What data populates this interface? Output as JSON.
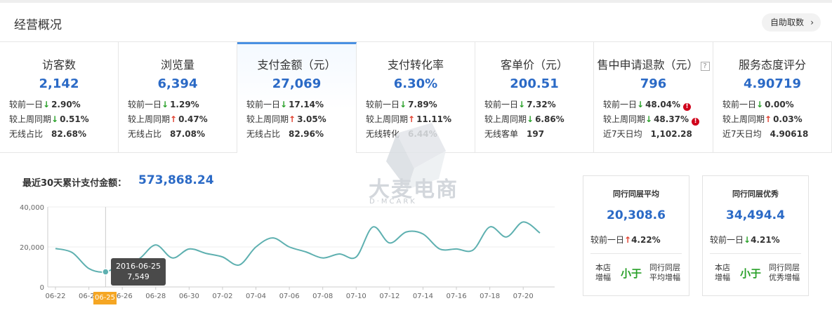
{
  "header": {
    "title": "经营概况",
    "button": "自助取数"
  },
  "metrics": [
    {
      "label": "访客数",
      "value": "2,142",
      "rows": [
        {
          "label": "较前一日",
          "dir": "down",
          "value": "2.90%"
        },
        {
          "label": "较上周同期",
          "dir": "down",
          "value": "0.51%"
        },
        {
          "label": "无线占比",
          "dir": "",
          "value": "82.68%"
        }
      ]
    },
    {
      "label": "浏览量",
      "value": "6,394",
      "rows": [
        {
          "label": "较前一日",
          "dir": "down",
          "value": "1.29%"
        },
        {
          "label": "较上周同期",
          "dir": "up",
          "value": "0.47%"
        },
        {
          "label": "无线占比",
          "dir": "",
          "value": "87.08%"
        }
      ]
    },
    {
      "label": "支付金额（元）",
      "value": "27,069",
      "rows": [
        {
          "label": "较前一日",
          "dir": "down",
          "value": "17.14%"
        },
        {
          "label": "较上周同期",
          "dir": "up",
          "value": "3.05%"
        },
        {
          "label": "无线占比",
          "dir": "",
          "value": "82.96%"
        }
      ]
    },
    {
      "label": "支付转化率",
      "value": "6.30%",
      "rows": [
        {
          "label": "较前一日",
          "dir": "down",
          "value": "7.89%"
        },
        {
          "label": "较上周同期",
          "dir": "up",
          "value": "11.11%"
        },
        {
          "label": "无线转化",
          "dir": "",
          "value": "6.44%"
        }
      ]
    },
    {
      "label": "客单价（元）",
      "value": "200.51",
      "rows": [
        {
          "label": "较前一日",
          "dir": "down",
          "value": "7.32%"
        },
        {
          "label": "较上周同期",
          "dir": "down",
          "value": "6.86%"
        },
        {
          "label": "无线客单",
          "dir": "",
          "value": "197"
        }
      ]
    },
    {
      "label": "售中申请退款（元）",
      "value": "796",
      "rows": [
        {
          "label": "较前一日",
          "dir": "down",
          "value": "48.04%",
          "alert": "!"
        },
        {
          "label": "较上周同期",
          "dir": "down",
          "value": "48.37%",
          "alert": "!"
        },
        {
          "label": "近7天日均",
          "dir": "",
          "value": "1,102.28"
        }
      ]
    },
    {
      "label": "服务态度评分",
      "value": "4.90719",
      "rows": [
        {
          "label": "较前一日",
          "dir": "down",
          "value": "0.00%"
        },
        {
          "label": "较上周同期",
          "dir": "up",
          "value": "0.03%"
        },
        {
          "label": "近7天日均",
          "dir": "",
          "value": "4.90618"
        }
      ]
    }
  ],
  "help_mark": "?",
  "watermark": {
    "text": "大麦电商",
    "sub": "D·MCARK"
  },
  "chart_section": {
    "title": "最近30天累计支付金额：",
    "total": "573,868.24"
  },
  "chart_data": {
    "type": "line",
    "x": [
      "06-22",
      "06-23",
      "06-24",
      "06-25",
      "06-26",
      "06-27",
      "06-28",
      "06-29",
      "06-30",
      "07-01",
      "07-02",
      "07-03",
      "07-04",
      "07-05",
      "07-06",
      "07-07",
      "07-08",
      "07-09",
      "07-10",
      "07-11",
      "07-12",
      "07-13",
      "07-14",
      "07-15",
      "07-16",
      "07-17",
      "07-18",
      "07-19",
      "07-20",
      "07-21"
    ],
    "values": [
      19200,
      17200,
      9200,
      7549,
      11500,
      14000,
      21000,
      14500,
      19000,
      16800,
      15000,
      11000,
      20000,
      24500,
      20000,
      17500,
      14500,
      16500,
      15000,
      30000,
      22000,
      27500,
      26500,
      19000,
      19000,
      18500,
      30000,
      25000,
      32500,
      27000
    ],
    "ylim": [
      0,
      40000
    ],
    "yticks": [
      "40,000",
      "20,000",
      "0"
    ],
    "xticks": [
      "06-22",
      "06-24",
      "06-26",
      "06-28",
      "06-30",
      "07-02",
      "07-04",
      "07-06",
      "07-08",
      "07-10",
      "07-12",
      "07-14",
      "07-16",
      "07-18",
      "07-20"
    ],
    "color": "#5eb0b0",
    "selected_index": 3
  },
  "tooltip": {
    "date": "2016-06-25",
    "value": "7,549"
  },
  "x_selected": "06-25",
  "peers": [
    {
      "title": "同行同层平均",
      "value": "20,308.6",
      "change_label": "较前一日",
      "dir": "up",
      "change": "4.22%",
      "cmp_left": [
        "本店",
        "增幅"
      ],
      "cmp_mid": "小于",
      "cmp_right": [
        "同行同层",
        "平均增幅"
      ]
    },
    {
      "title": "同行同层优秀",
      "value": "34,494.4",
      "change_label": "较前一日",
      "dir": "down",
      "change": "4.21%",
      "cmp_left": [
        "本店",
        "增幅"
      ],
      "cmp_mid": "小于",
      "cmp_right": [
        "同行同层",
        "优秀增幅"
      ]
    }
  ]
}
